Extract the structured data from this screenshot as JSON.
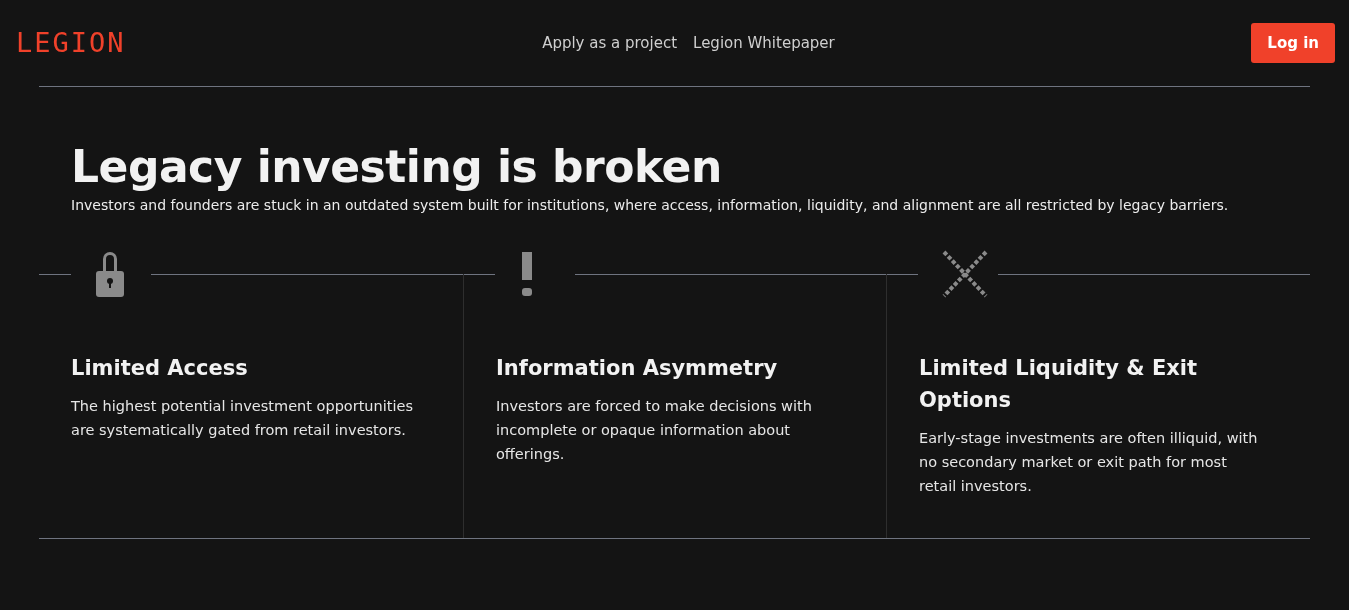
{
  "header": {
    "logo": "LEGION",
    "nav_links": [
      "Apply as a project",
      "Legion Whitepaper"
    ],
    "login_button": "Log in"
  },
  "hero": {
    "title": "Legacy investing is broken",
    "subtitle": "Investors and founders are stuck in an outdated system built for institutions, where access, information, liquidity, and alignment are all restricted by legacy barriers."
  },
  "features": [
    {
      "title": "Limited Access",
      "text": "The highest potential investment opportunities are systematically gated from retail investors."
    },
    {
      "title": "Information Asymmetry",
      "text": "Investors are forced to make decisions with incomplete or opaque information about offerings."
    },
    {
      "title": "Limited Liquidity & Exit Options",
      "text": "Early-stage investments are often illiquid, with no secondary market or exit path for most retail investors."
    }
  ]
}
